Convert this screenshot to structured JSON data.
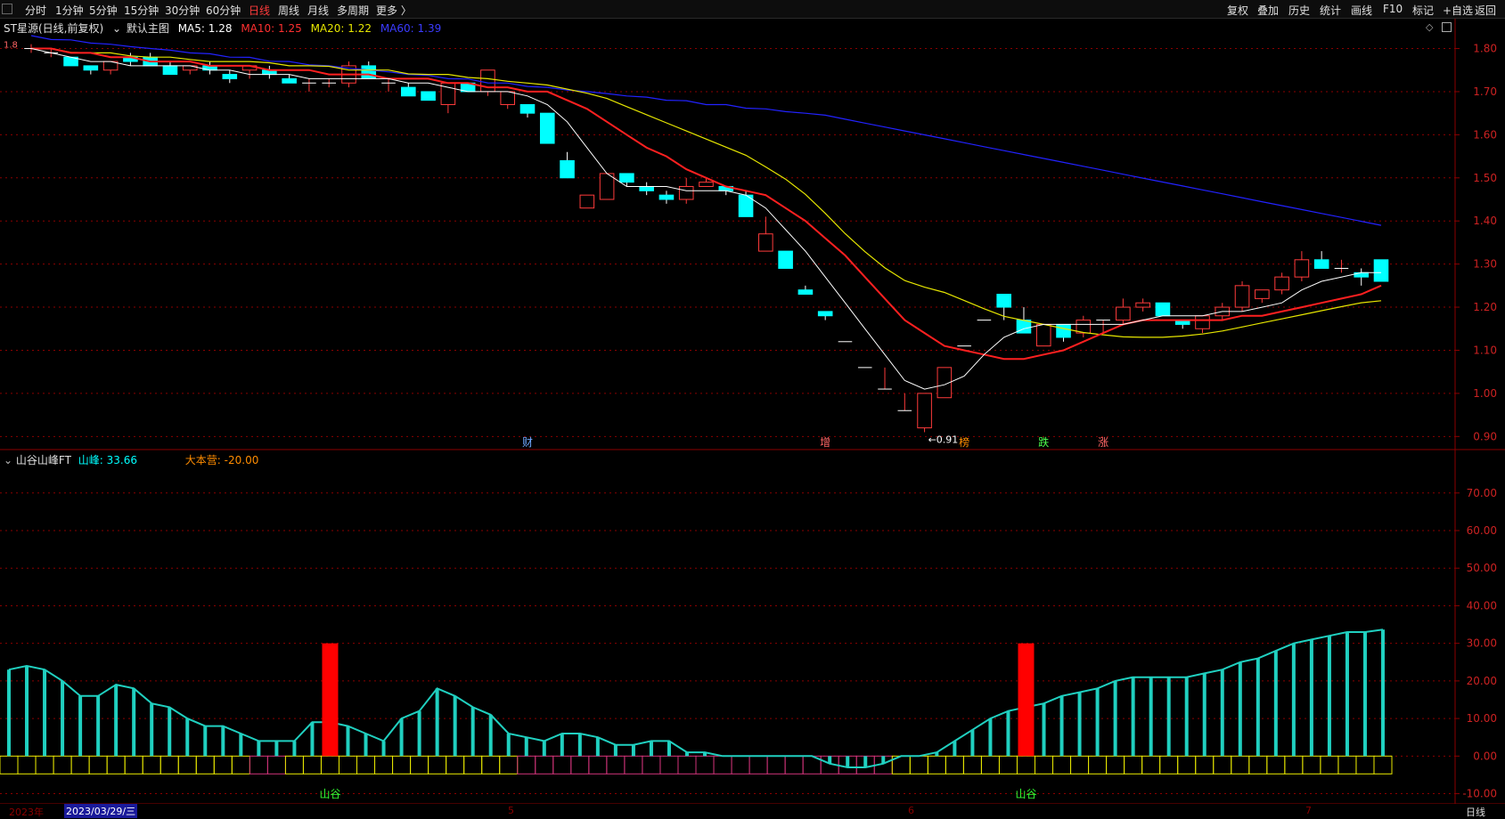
{
  "topbar": {
    "tabs": [
      "分时",
      "1分钟",
      "5分钟",
      "15分钟",
      "30分钟",
      "60分钟",
      "日线",
      "周线",
      "月线",
      "多周期",
      "更多 〉"
    ],
    "active_tab": "日线",
    "right_buttons": [
      "复权",
      "叠加",
      "历史",
      "统计",
      "画线",
      "F10",
      "标记",
      "+自选",
      "返回"
    ]
  },
  "main_legend": {
    "stock": "ST星源(日线,前复权)",
    "chart_label": "默认主图",
    "ma5": "MA5: 1.28",
    "ma10": "MA10: 1.25",
    "ma20": "MA20: 1.22",
    "ma60": "MA60: 1.39",
    "min_label": "←0.91",
    "top_label": "1.8",
    "icons": [
      "diamond-icon",
      "window-icon"
    ]
  },
  "price_axis": [
    "1.80",
    "1.70",
    "1.60",
    "1.50",
    "1.40",
    "1.30",
    "1.20",
    "1.10",
    "1.00",
    "0.90"
  ],
  "markers": [
    "财",
    "增",
    "榜",
    "跌",
    "涨"
  ],
  "indicator": {
    "name": "山谷山峰FT",
    "shanfeng": "山峰: 33.66",
    "dabenying": "大本营: -20.00",
    "valley_label": "山谷",
    "axis": [
      "70.00",
      "60.00",
      "50.00",
      "40.00",
      "30.00",
      "20.00",
      "10.00",
      "0.00",
      "-10.00"
    ]
  },
  "date_axis": {
    "year": "2023年",
    "selected": "2023/03/29/三",
    "months": [
      "5",
      "6",
      "7"
    ],
    "period": "日线"
  },
  "colors": {
    "up": "#ff3b3b",
    "down": "#00ffff",
    "ma5": "#ffffff",
    "ma10": "#ff2020",
    "ma20": "#e6e600",
    "ma60": "#2222ff",
    "grid": "#8b0000"
  },
  "chart_data": [
    {
      "type": "candlestick",
      "title": "ST星源(日线,前复权)",
      "ylim": [
        0.88,
        1.83
      ],
      "ohlc": [
        [
          1.8,
          1.81,
          1.79,
          1.8
        ],
        [
          1.79,
          1.8,
          1.78,
          1.79
        ],
        [
          1.78,
          1.78,
          1.76,
          1.76
        ],
        [
          1.76,
          1.76,
          1.74,
          1.75
        ],
        [
          1.75,
          1.77,
          1.74,
          1.77
        ],
        [
          1.78,
          1.79,
          1.76,
          1.77
        ],
        [
          1.78,
          1.79,
          1.76,
          1.76
        ],
        [
          1.76,
          1.77,
          1.74,
          1.74
        ],
        [
          1.75,
          1.76,
          1.74,
          1.76
        ],
        [
          1.76,
          1.77,
          1.74,
          1.75
        ],
        [
          1.74,
          1.75,
          1.72,
          1.73
        ],
        [
          1.75,
          1.76,
          1.73,
          1.76
        ],
        [
          1.75,
          1.76,
          1.73,
          1.74
        ],
        [
          1.73,
          1.74,
          1.72,
          1.72
        ],
        [
          1.72,
          1.73,
          1.7,
          1.72
        ],
        [
          1.72,
          1.73,
          1.71,
          1.72
        ],
        [
          1.72,
          1.77,
          1.71,
          1.76
        ],
        [
          1.76,
          1.77,
          1.73,
          1.73
        ],
        [
          1.72,
          1.73,
          1.7,
          1.72
        ],
        [
          1.71,
          1.72,
          1.69,
          1.69
        ],
        [
          1.7,
          1.7,
          1.68,
          1.68
        ],
        [
          1.67,
          1.72,
          1.65,
          1.72
        ],
        [
          1.72,
          1.72,
          1.7,
          1.7
        ],
        [
          1.7,
          1.75,
          1.69,
          1.75
        ],
        [
          1.67,
          1.7,
          1.66,
          1.7
        ],
        [
          1.67,
          1.67,
          1.64,
          1.65
        ],
        [
          1.65,
          1.65,
          1.58,
          1.58
        ],
        [
          1.54,
          1.56,
          1.5,
          1.5
        ],
        [
          1.43,
          1.46,
          1.43,
          1.46
        ],
        [
          1.45,
          1.51,
          1.45,
          1.51
        ],
        [
          1.51,
          1.51,
          1.48,
          1.49
        ],
        [
          1.48,
          1.49,
          1.46,
          1.47
        ],
        [
          1.46,
          1.47,
          1.44,
          1.45
        ],
        [
          1.45,
          1.5,
          1.44,
          1.48
        ],
        [
          1.48,
          1.5,
          1.48,
          1.49
        ],
        [
          1.48,
          1.48,
          1.46,
          1.47
        ],
        [
          1.46,
          1.47,
          1.41,
          1.41
        ],
        [
          1.33,
          1.41,
          1.33,
          1.37
        ],
        [
          1.33,
          1.33,
          1.29,
          1.29
        ],
        [
          1.24,
          1.25,
          1.23,
          1.23
        ],
        [
          1.19,
          1.19,
          1.17,
          1.18
        ],
        [
          1.12,
          1.12,
          1.12,
          1.12
        ],
        [
          1.06,
          1.06,
          1.06,
          1.06
        ],
        [
          1.01,
          1.06,
          1.01,
          1.01
        ],
        [
          0.96,
          1.0,
          0.96,
          0.96
        ],
        [
          0.92,
          1.0,
          0.91,
          1.0
        ],
        [
          0.99,
          1.06,
          0.99,
          1.06
        ],
        [
          1.11,
          1.11,
          1.11,
          1.11
        ],
        [
          1.17,
          1.17,
          1.17,
          1.17
        ],
        [
          1.23,
          1.23,
          1.17,
          1.2
        ],
        [
          1.17,
          1.2,
          1.14,
          1.14
        ],
        [
          1.11,
          1.16,
          1.11,
          1.16
        ],
        [
          1.16,
          1.16,
          1.12,
          1.13
        ],
        [
          1.14,
          1.18,
          1.13,
          1.17
        ],
        [
          1.17,
          1.17,
          1.14,
          1.17
        ],
        [
          1.17,
          1.22,
          1.16,
          1.2
        ],
        [
          1.2,
          1.22,
          1.19,
          1.21
        ],
        [
          1.21,
          1.21,
          1.18,
          1.18
        ],
        [
          1.17,
          1.17,
          1.15,
          1.16
        ],
        [
          1.15,
          1.18,
          1.14,
          1.18
        ],
        [
          1.18,
          1.21,
          1.17,
          1.2
        ],
        [
          1.2,
          1.26,
          1.19,
          1.25
        ],
        [
          1.22,
          1.24,
          1.21,
          1.24
        ],
        [
          1.24,
          1.28,
          1.23,
          1.27
        ],
        [
          1.27,
          1.33,
          1.26,
          1.31
        ],
        [
          1.31,
          1.33,
          1.29,
          1.29
        ],
        [
          1.29,
          1.31,
          1.28,
          1.29
        ],
        [
          1.28,
          1.29,
          1.25,
          1.27
        ],
        [
          1.31,
          1.31,
          1.26,
          1.26
        ]
      ],
      "ma5": [
        1.8,
        1.79,
        1.78,
        1.77,
        1.77,
        1.76,
        1.76,
        1.76,
        1.76,
        1.75,
        1.75,
        1.74,
        1.74,
        1.74,
        1.73,
        1.73,
        1.73,
        1.73,
        1.73,
        1.72,
        1.72,
        1.71,
        1.7,
        1.7,
        1.7,
        1.69,
        1.67,
        1.63,
        1.57,
        1.51,
        1.48,
        1.48,
        1.48,
        1.47,
        1.47,
        1.47,
        1.46,
        1.43,
        1.38,
        1.33,
        1.27,
        1.21,
        1.15,
        1.09,
        1.03,
        1.01,
        1.02,
        1.04,
        1.09,
        1.13,
        1.15,
        1.16,
        1.16,
        1.16,
        1.16,
        1.16,
        1.17,
        1.18,
        1.18,
        1.18,
        1.19,
        1.19,
        1.2,
        1.21,
        1.24,
        1.26,
        1.27,
        1.28,
        1.28
      ],
      "ma10": [
        1.8,
        1.8,
        1.79,
        1.79,
        1.78,
        1.78,
        1.77,
        1.77,
        1.77,
        1.76,
        1.76,
        1.76,
        1.75,
        1.75,
        1.75,
        1.74,
        1.74,
        1.74,
        1.73,
        1.73,
        1.73,
        1.72,
        1.72,
        1.71,
        1.71,
        1.7,
        1.7,
        1.68,
        1.66,
        1.63,
        1.6,
        1.57,
        1.55,
        1.52,
        1.5,
        1.48,
        1.47,
        1.46,
        1.43,
        1.4,
        1.36,
        1.32,
        1.27,
        1.22,
        1.17,
        1.14,
        1.11,
        1.1,
        1.09,
        1.08,
        1.08,
        1.09,
        1.1,
        1.12,
        1.14,
        1.16,
        1.17,
        1.17,
        1.17,
        1.17,
        1.17,
        1.18,
        1.18,
        1.19,
        1.2,
        1.21,
        1.22,
        1.23,
        1.25
      ],
      "ma20": [
        1.8,
        1.8,
        1.79,
        1.79,
        1.79,
        1.78,
        1.78,
        1.78,
        1.77,
        1.77,
        1.77,
        1.77,
        1.76,
        1.76,
        1.76,
        1.75,
        1.75,
        1.75,
        1.74,
        1.74,
        1.74,
        1.73,
        1.73,
        1.72,
        1.72,
        1.71,
        1.7,
        1.69,
        1.67,
        1.65,
        1.63,
        1.61,
        1.59,
        1.57,
        1.55,
        1.52,
        1.49,
        1.45,
        1.4,
        1.35,
        1.31,
        1.27,
        1.25,
        1.24,
        1.22,
        1.2,
        1.18,
        1.17,
        1.16,
        1.15,
        1.14,
        1.135,
        1.13,
        1.13,
        1.13,
        1.135,
        1.14,
        1.15,
        1.16,
        1.17,
        1.18,
        1.19,
        1.2,
        1.21,
        1.215
      ],
      "ma60": [
        1.83,
        1.82,
        1.82,
        1.81,
        1.81,
        1.8,
        1.8,
        1.79,
        1.79,
        1.78,
        1.78,
        1.77,
        1.77,
        1.76,
        1.76,
        1.75,
        1.75,
        1.74,
        1.74,
        1.73,
        1.73,
        1.72,
        1.72,
        1.71,
        1.71,
        1.7,
        1.7,
        1.69,
        1.69,
        1.68,
        1.68,
        1.67,
        1.67,
        1.66,
        1.66,
        1.65,
        1.65,
        1.64,
        1.63,
        1.62,
        1.61,
        1.6,
        1.59,
        1.58,
        1.57,
        1.56,
        1.55,
        1.54,
        1.53,
        1.52,
        1.51,
        1.5,
        1.49,
        1.48,
        1.47,
        1.46,
        1.45,
        1.44,
        1.43,
        1.42,
        1.41,
        1.4,
        1.39
      ]
    },
    {
      "type": "bar",
      "title": "山谷山峰FT",
      "ylim": [
        -12,
        78
      ],
      "values": [
        23,
        24,
        23,
        20,
        16,
        16,
        19,
        18,
        14,
        13,
        10,
        8,
        8,
        6,
        4,
        4,
        4,
        9,
        9,
        8,
        6,
        4,
        10,
        12,
        18,
        16,
        13,
        11,
        6,
        5,
        4,
        6,
        6,
        5,
        3,
        3,
        4,
        4,
        1,
        1,
        0,
        0,
        0,
        0,
        0,
        0,
        -2,
        -3,
        -3,
        -2,
        0,
        0,
        1,
        4,
        7,
        10,
        12,
        13,
        14,
        16,
        17,
        18,
        20,
        21,
        21,
        21,
        21,
        22,
        23,
        25,
        26,
        28,
        30,
        31,
        32,
        33,
        33,
        33.66
      ],
      "signals": [
        {
          "index": 16,
          "value": 30,
          "label": "山谷"
        },
        {
          "index": 50,
          "value": 30,
          "label": "山谷"
        }
      ]
    }
  ]
}
